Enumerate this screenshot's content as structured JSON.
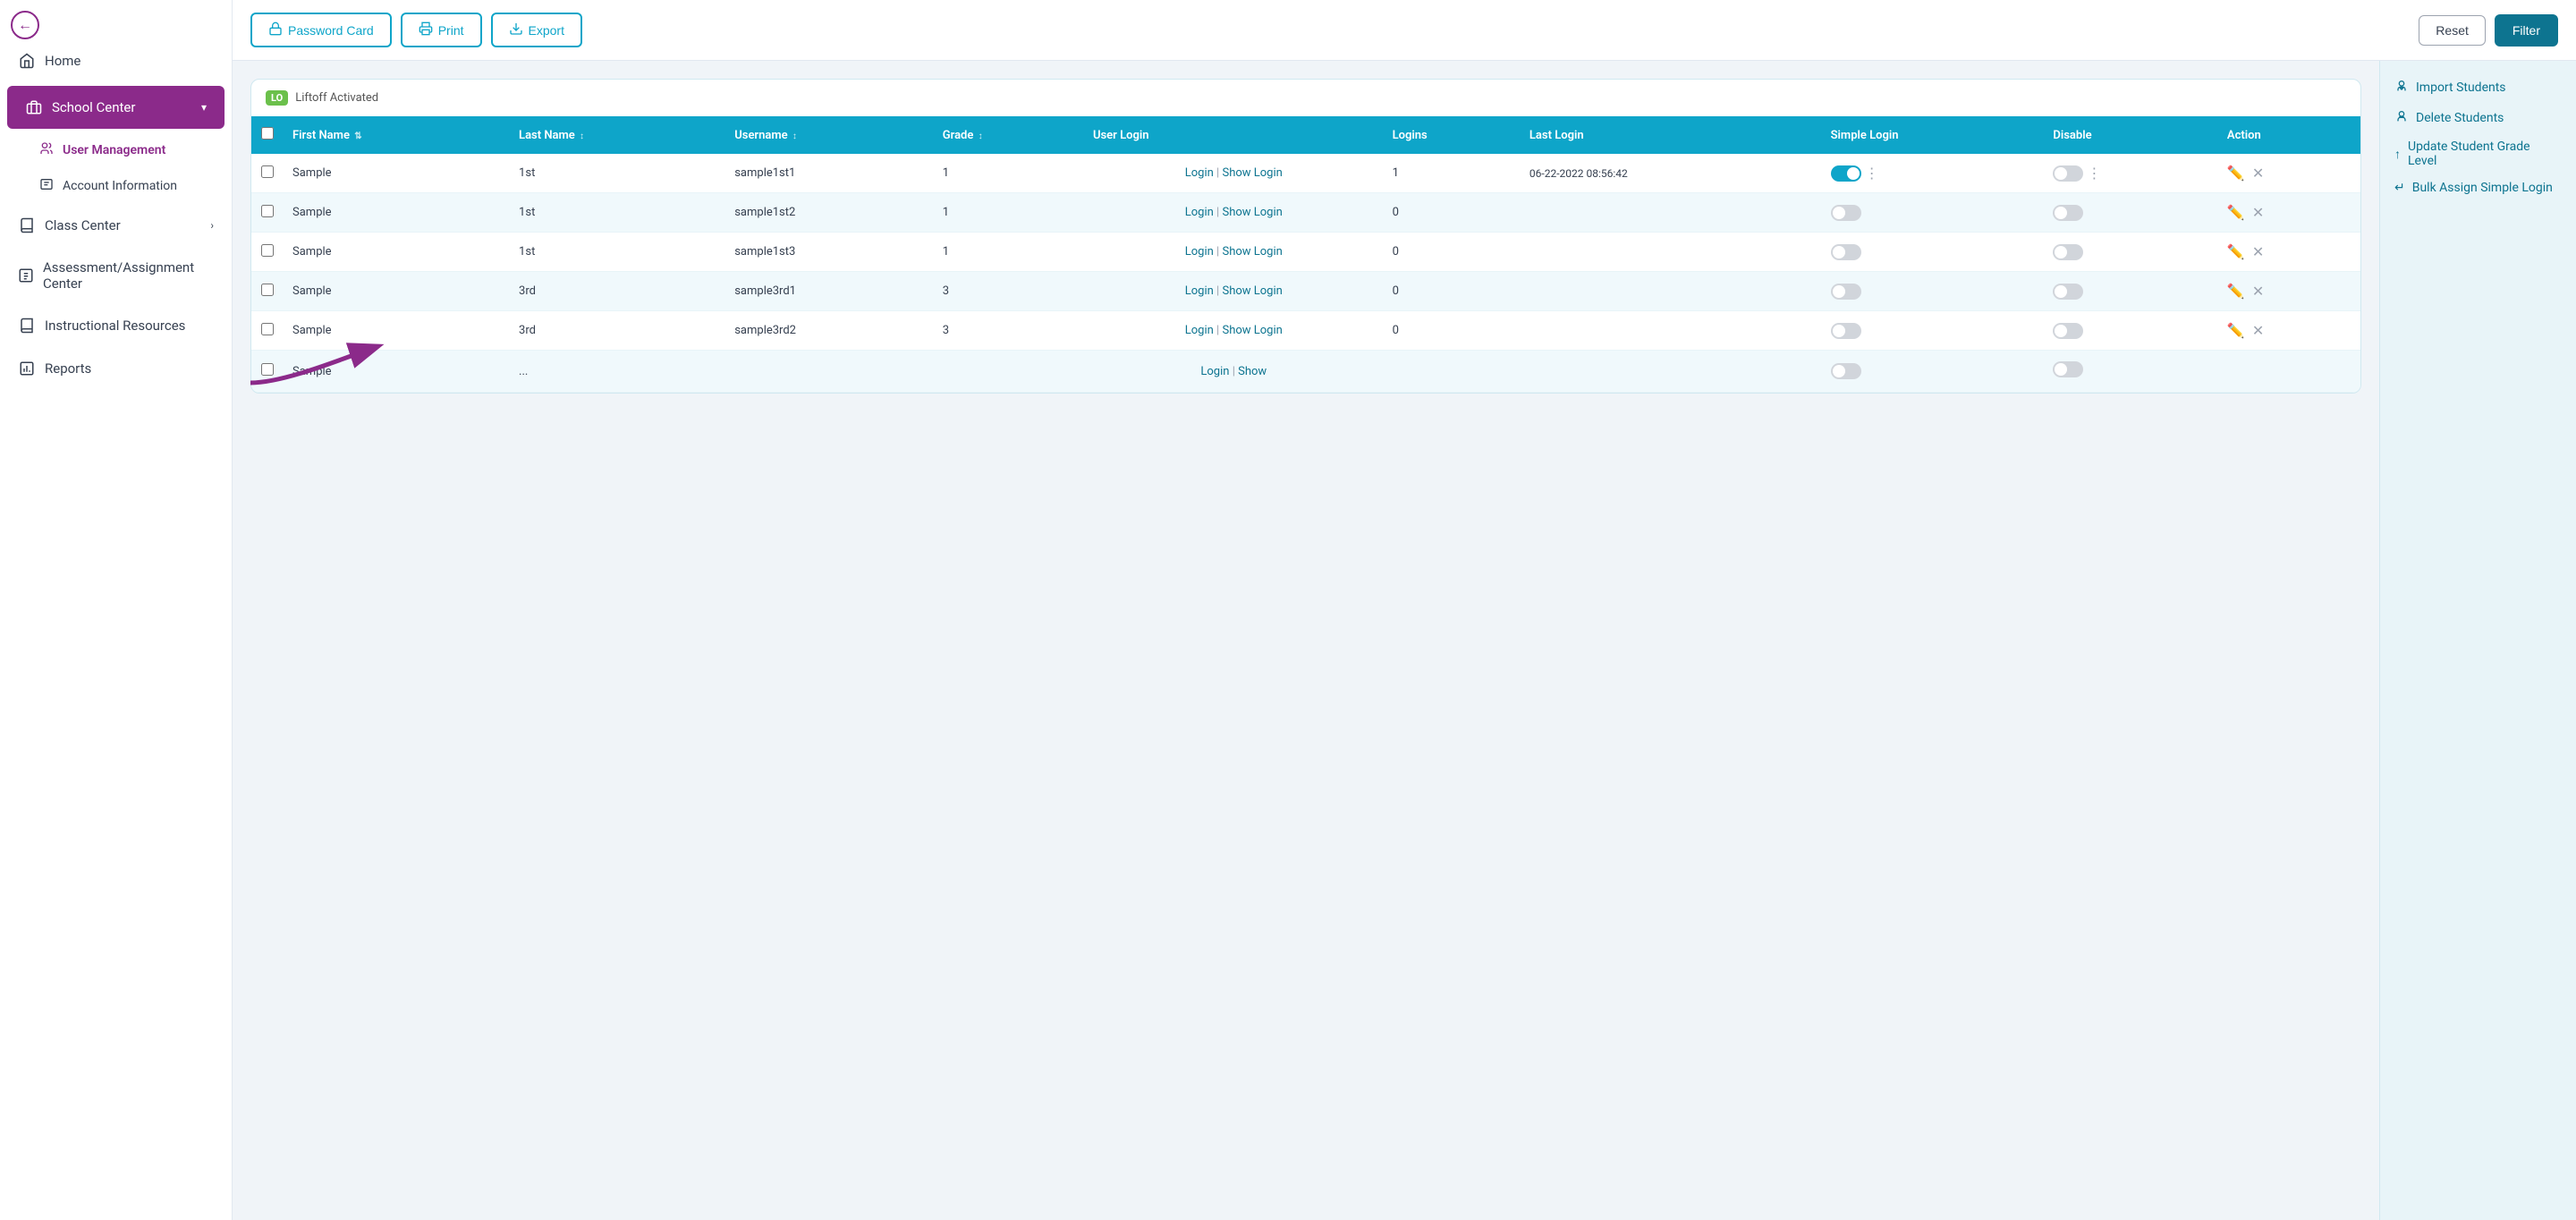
{
  "sidebar": {
    "back_button": "←",
    "items": [
      {
        "id": "home",
        "label": "Home",
        "icon": "🏠",
        "active": false
      },
      {
        "id": "school-center",
        "label": "School Center",
        "icon": "🏫",
        "active": true,
        "expanded": true
      },
      {
        "id": "user-management",
        "label": "User Management",
        "sub": true,
        "active": false
      },
      {
        "id": "account-information",
        "label": "Account Information",
        "sub": true,
        "active": false
      },
      {
        "id": "class-center",
        "label": "Class Center",
        "icon": "📚",
        "active": false,
        "has_arrow": true
      },
      {
        "id": "assessment-center",
        "label": "Assessment/Assignment Center",
        "icon": "📋",
        "active": false
      },
      {
        "id": "instructional-resources",
        "label": "Instructional Resources",
        "icon": "📖",
        "active": false
      },
      {
        "id": "reports",
        "label": "Reports",
        "icon": "📊",
        "active": false
      }
    ]
  },
  "toolbar": {
    "password_card_label": "Password Card",
    "print_label": "Print",
    "export_label": "Export",
    "reset_label": "Reset",
    "filter_label": "Filter"
  },
  "right_panel": {
    "import_students": "Import Students",
    "delete_students": "Delete Students",
    "update_grade_level": "Update Student Grade Level",
    "bulk_assign": "Bulk Assign Simple Login"
  },
  "table": {
    "liftoff_badge": "LO",
    "liftoff_text": "Liftoff Activated",
    "columns": [
      "",
      "First Name",
      "Last Name",
      "Username",
      "Grade",
      "User Login",
      "Logins",
      "Last Login",
      "Simple Login",
      "Disable",
      "Action"
    ],
    "rows": [
      {
        "first": "Sample",
        "last": "1st",
        "username": "sample1st1",
        "grade": "1",
        "login_link": "Login",
        "show_link": "Show Login",
        "logins": "1",
        "last_login": "06-22-2022 08:56:42",
        "simple_toggle": true,
        "disable_toggle": false
      },
      {
        "first": "Sample",
        "last": "1st",
        "username": "sample1st2",
        "grade": "1",
        "login_link": "Login",
        "show_link": "Show Login",
        "logins": "0",
        "last_login": "",
        "simple_toggle": false,
        "disable_toggle": false
      },
      {
        "first": "Sample",
        "last": "1st",
        "username": "sample1st3",
        "grade": "1",
        "login_link": "Login",
        "show_link": "Show Login",
        "logins": "0",
        "last_login": "",
        "simple_toggle": false,
        "disable_toggle": false
      },
      {
        "first": "Sample",
        "last": "3rd",
        "username": "sample3rd1",
        "grade": "3",
        "login_link": "Login",
        "show_link": "Show Login",
        "logins": "0",
        "last_login": "",
        "simple_toggle": false,
        "disable_toggle": false
      },
      {
        "first": "Sample",
        "last": "3rd",
        "username": "sample3rd2",
        "grade": "3",
        "login_link": "Login",
        "show_link": "Show Login",
        "logins": "0",
        "last_login": "",
        "simple_toggle": false,
        "disable_toggle": false
      },
      {
        "first": "Sample",
        "last": "...",
        "username": "...",
        "grade": "...",
        "login_link": "Login",
        "show_link": "Show",
        "logins": "",
        "last_login": "",
        "simple_toggle": false,
        "disable_toggle": false
      }
    ]
  }
}
